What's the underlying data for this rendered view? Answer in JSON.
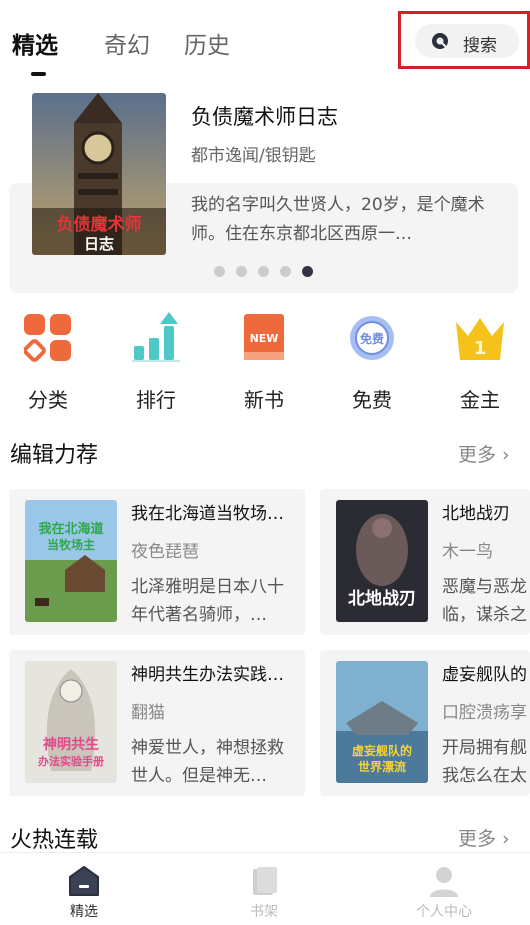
{
  "tabs": [
    {
      "label": "精选",
      "active": true
    },
    {
      "label": "奇幻",
      "active": false
    },
    {
      "label": "历史",
      "active": false
    }
  ],
  "search": {
    "label": "搜索",
    "icon": "search-icon"
  },
  "featured": {
    "title": "负债魔术师日志",
    "meta": "都市逸闻/银钥匙",
    "description": "我的名字叫久世贤人，20岁，是个魔术师。住在东京都北区西原一…",
    "cover_text": [
      "负债魔术师",
      "日志"
    ],
    "carousel_dots": 5,
    "carousel_active": 5
  },
  "categories": [
    {
      "label": "分类",
      "icon": "category-grid-icon"
    },
    {
      "label": "排行",
      "icon": "ranking-chart-icon"
    },
    {
      "label": "新书",
      "icon": "new-book-icon"
    },
    {
      "label": "免费",
      "icon": "free-badge-icon"
    },
    {
      "label": "金主",
      "icon": "crown-icon"
    }
  ],
  "sections": {
    "editor": {
      "title": "编辑力荐",
      "more": "更多 ›"
    },
    "hot": {
      "title": "火热连载",
      "more": "更多 ›"
    }
  },
  "books": [
    {
      "title": "我在北海道当牧场…",
      "author": "夜色琵琶",
      "description": "北泽雅明是日本八十年代著名骑师，…",
      "cover_text": [
        "我在北海道",
        "当牧场主"
      ]
    },
    {
      "title": "北地战刃",
      "author": "木一鸟",
      "description": "恶魔与恶龙临，谋杀之",
      "cover_text": [
        "北地战刃"
      ]
    },
    {
      "title": "神明共生办法实践…",
      "author": "翻猫",
      "description": "神爱世人，神想拯救世人。但是神无…",
      "cover_text": [
        "神明共生",
        "办法实验手册"
      ]
    },
    {
      "title": "虚妄舰队的",
      "author": "口腔溃疡享",
      "description": "开局拥有舰我怎么在太",
      "cover_text": [
        "虚妄舰队的",
        "世界漂流"
      ]
    }
  ],
  "bottom_nav": [
    {
      "label": "精选",
      "icon": "home-featured-icon",
      "active": true
    },
    {
      "label": "书架",
      "icon": "bookshelf-icon",
      "active": false
    },
    {
      "label": "个人中心",
      "icon": "profile-icon",
      "active": false
    }
  ],
  "colors": {
    "highlight_border": "#d4202a",
    "accent_orange": "#ee6a3c",
    "accent_teal": "#4ec9c6",
    "gold": "#f5c21b",
    "free_blue": "#6f8fe0"
  }
}
